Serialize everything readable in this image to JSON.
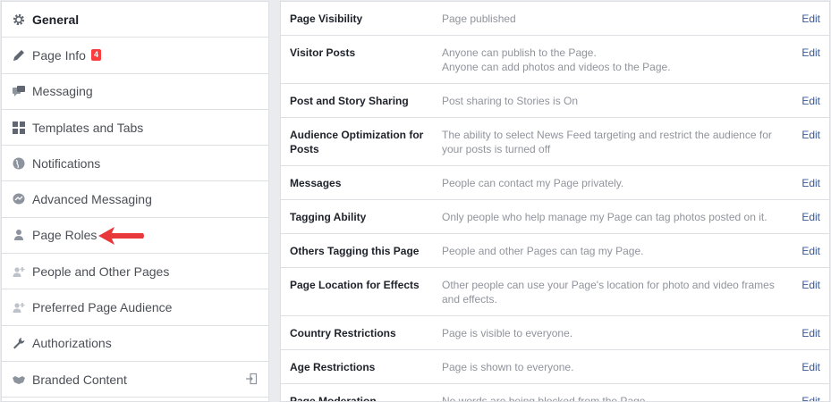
{
  "sidebar": {
    "items": [
      {
        "label": "General",
        "icon": "gear-icon",
        "active": true
      },
      {
        "label": "Page Info",
        "icon": "pencil-icon",
        "badge": "4"
      },
      {
        "label": "Messaging",
        "icon": "chat-bubbles-icon"
      },
      {
        "label": "Templates and Tabs",
        "icon": "grid-icon"
      },
      {
        "label": "Notifications",
        "icon": "globe-icon"
      },
      {
        "label": "Advanced Messaging",
        "icon": "messenger-icon"
      },
      {
        "label": "Page Roles",
        "icon": "person-icon"
      },
      {
        "label": "People and Other Pages",
        "icon": "add-person-icon"
      },
      {
        "label": "Preferred Page Audience",
        "icon": "add-person-icon"
      },
      {
        "label": "Authorizations",
        "icon": "wrench-icon"
      },
      {
        "label": "Branded Content",
        "icon": "handshake-icon",
        "external": "external-link-icon"
      }
    ]
  },
  "settings": {
    "edit_label": "Edit",
    "rows": [
      {
        "label": "Page Visibility",
        "lines": [
          "Page published"
        ]
      },
      {
        "label": "Visitor Posts",
        "lines": [
          "Anyone can publish to the Page.",
          "Anyone can add photos and videos to the Page."
        ]
      },
      {
        "label": "Post and Story Sharing",
        "lines": [
          "Post sharing to Stories is On"
        ]
      },
      {
        "label": "Audience Optimization for Posts",
        "lines": [
          "The ability to select News Feed targeting and restrict the audience for",
          "your posts is turned off"
        ]
      },
      {
        "label": "Messages",
        "lines": [
          "People can contact my Page privately."
        ]
      },
      {
        "label": "Tagging Ability",
        "lines": [
          "Only people who help manage my Page can tag photos posted on it."
        ]
      },
      {
        "label": "Others Tagging this Page",
        "lines": [
          "People and other Pages can tag my Page."
        ]
      },
      {
        "label": "Page Location for Effects",
        "lines": [
          "Other people can use your Page's location for photo and video frames",
          "and effects."
        ]
      },
      {
        "label": "Country Restrictions",
        "lines": [
          "Page is visible to everyone."
        ]
      },
      {
        "label": "Age Restrictions",
        "lines": [
          "Page is shown to everyone."
        ]
      },
      {
        "label": "Page Moderation",
        "lines": [
          "No words are being blocked from the Page."
        ]
      }
    ]
  },
  "colors": {
    "badge": "#fa3e3e",
    "arrow": "#e8383c",
    "link": "#365899",
    "muted": "#90949c"
  }
}
